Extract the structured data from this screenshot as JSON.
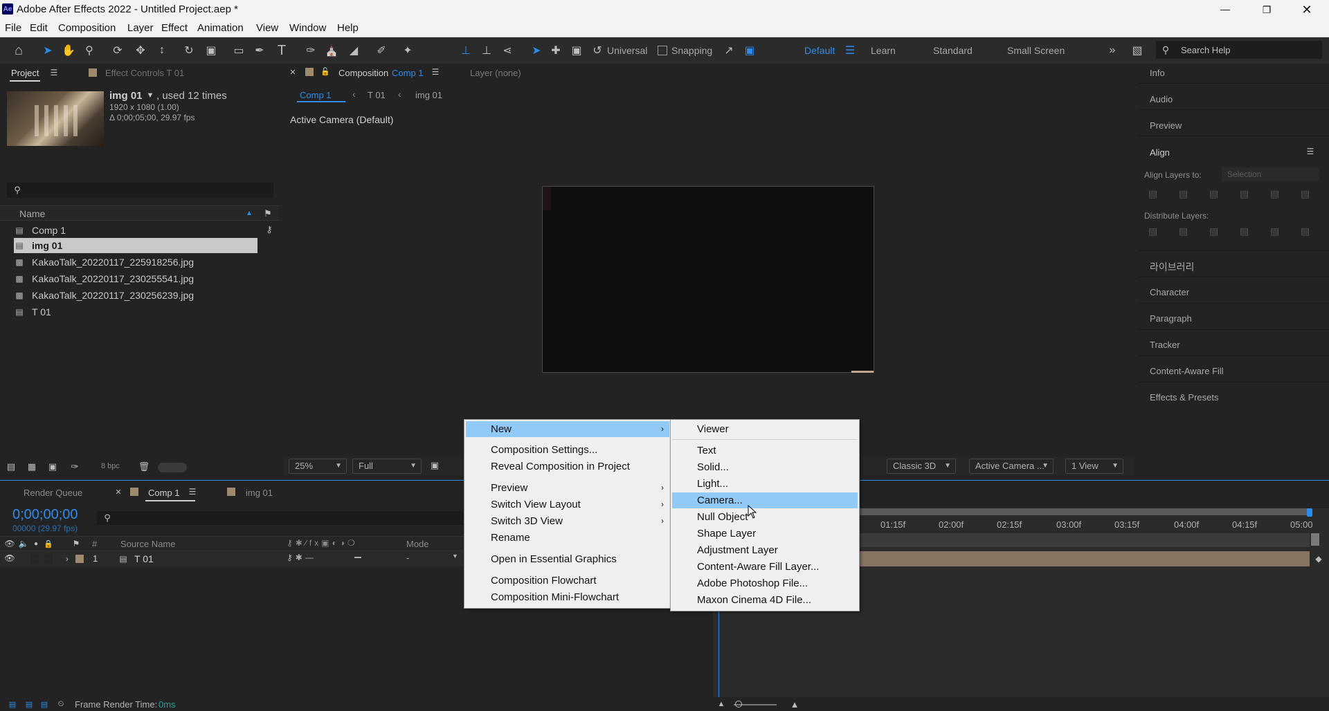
{
  "app": {
    "title": "Adobe After Effects 2022 - Untitled Project.aep *",
    "logo": "Ae"
  },
  "menu": [
    "File",
    "Edit",
    "Composition",
    "Layer",
    "Effect",
    "Animation",
    "View",
    "Window",
    "Help"
  ],
  "toolbar": {
    "universal": "Universal",
    "snapping": "Snapping",
    "workspaces": [
      "Default",
      "Learn",
      "Standard",
      "Small Screen"
    ],
    "search_placeholder": "Search Help"
  },
  "project_panel": {
    "tabs": [
      "Project",
      "Effect Controls T 01"
    ],
    "selected_name": "img 01",
    "used": ", used 12 times",
    "dims": "1920 x 1080 (1.00)",
    "duration": "Δ 0;00;05;00, 29.97 fps",
    "name_header": "Name",
    "items": [
      {
        "name": "Comp 1",
        "type": "comp"
      },
      {
        "name": "img 01",
        "type": "comp"
      },
      {
        "name": "KakaoTalk_20220117_225918256.jpg",
        "type": "file"
      },
      {
        "name": "KakaoTalk_20220117_230255541.jpg",
        "type": "file"
      },
      {
        "name": "KakaoTalk_20220117_230256239.jpg",
        "type": "file"
      },
      {
        "name": "T 01",
        "type": "comp"
      }
    ],
    "bpc": "8 bpc"
  },
  "comp_panel": {
    "tab_prefix": "Composition",
    "tab_name": "Comp 1",
    "layer_tab": "Layer (none)",
    "breadcrumbs": [
      "Comp 1",
      "T 01",
      "img 01"
    ],
    "camera_label": "Active Camera (Default)",
    "zoom": "25%",
    "resolution": "Full",
    "renderer": "Classic 3D",
    "view_camera": "Active Camera ...",
    "views": "1 View"
  },
  "right_panels": {
    "items": [
      "Info",
      "Audio",
      "Preview",
      "Align"
    ],
    "align_to_label": "Align Layers to:",
    "align_to_value": "Selection",
    "distribute_label": "Distribute Layers:",
    "items2": [
      "라이브러리",
      "Character",
      "Paragraph",
      "Tracker",
      "Content-Aware Fill",
      "Effects & Presets"
    ]
  },
  "timeline": {
    "tabs": [
      "Render Queue",
      "Comp 1",
      "img 01"
    ],
    "timecode": "0;00;00;00",
    "frames": "00000 (29.97 fps)",
    "col_num": "#",
    "col_source": "Source Name",
    "col_mode": "Mode",
    "layer_num": "1",
    "layer_name": "T 01",
    "layer_mode": "-",
    "ruler": [
      "01:15f",
      "02:00f",
      "02:15f",
      "03:00f",
      "03:15f",
      "04:00f",
      "04:15f",
      "05:00"
    ],
    "render_time_label": "Frame Render Time:",
    "render_time_value": "0ms"
  },
  "context_menu": {
    "items": [
      "New",
      "Composition Settings...",
      "Reveal Composition in Project",
      "Preview",
      "Switch View Layout",
      "Switch 3D View",
      "Rename",
      "Open in Essential Graphics",
      "Composition Flowchart",
      "Composition Mini-Flowchart"
    ]
  },
  "submenu": {
    "items": [
      "Viewer",
      "Text",
      "Solid...",
      "Light...",
      "Camera...",
      "Null Object",
      "Shape Layer",
      "Adjustment Layer",
      "Content-Aware Fill Layer...",
      "Adobe Photoshop File...",
      "Maxon Cinema 4D File..."
    ]
  },
  "colors": {
    "accent": "#2d8ceb",
    "menu_highlight": "#91c9f7",
    "logo_bg": "#00005b",
    "layer_bar": "#857562"
  }
}
